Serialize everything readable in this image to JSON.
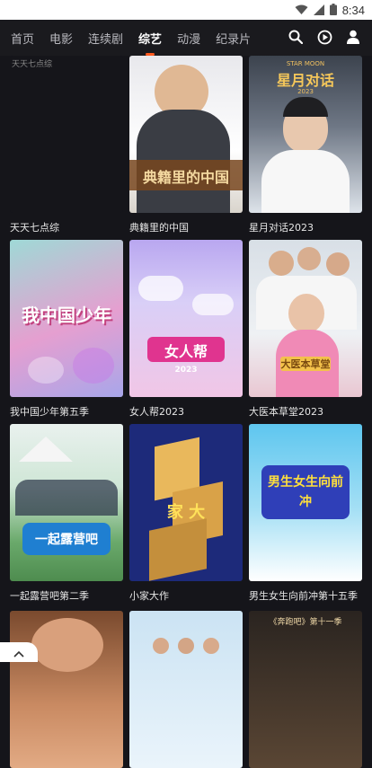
{
  "status_bar": {
    "time": "8:34"
  },
  "nav": {
    "tabs": [
      {
        "label": "首页",
        "active": false
      },
      {
        "label": "电影",
        "active": false
      },
      {
        "label": "连续剧",
        "active": false
      },
      {
        "label": "综艺",
        "active": true
      },
      {
        "label": "动漫",
        "active": false
      },
      {
        "label": "纪录片",
        "active": false
      }
    ],
    "icons": [
      "search-icon",
      "play-history-icon",
      "user-icon"
    ],
    "accent_color": "#ff5a1f"
  },
  "items": [
    {
      "title": "天天七点综",
      "poster_text": "天天七点综",
      "broken_image": true
    },
    {
      "title": "典籍里的中国",
      "poster_text": "典籍里的中国"
    },
    {
      "title": "星月对话2023",
      "poster_text": "星月对话",
      "poster_sub": "STAR MOON",
      "poster_year": "2023"
    },
    {
      "title": "我中国少年第五季",
      "poster_text": "我中国少年"
    },
    {
      "title": "女人帮2023",
      "poster_text": "女人帮",
      "poster_year": "2023"
    },
    {
      "title": "大医本草堂2023",
      "poster_text": "大医本草堂"
    },
    {
      "title": "一起露营吧第二季",
      "poster_text": "一起露营吧"
    },
    {
      "title": "小家大作",
      "poster_text": "家 大"
    },
    {
      "title": "男生女生向前冲第十五季",
      "poster_text": "男生女生向前冲"
    },
    {
      "title": "",
      "poster_text": ""
    },
    {
      "title": "",
      "poster_text": ""
    },
    {
      "title": "",
      "poster_text": "《奔跑吧》第十一季"
    }
  ]
}
